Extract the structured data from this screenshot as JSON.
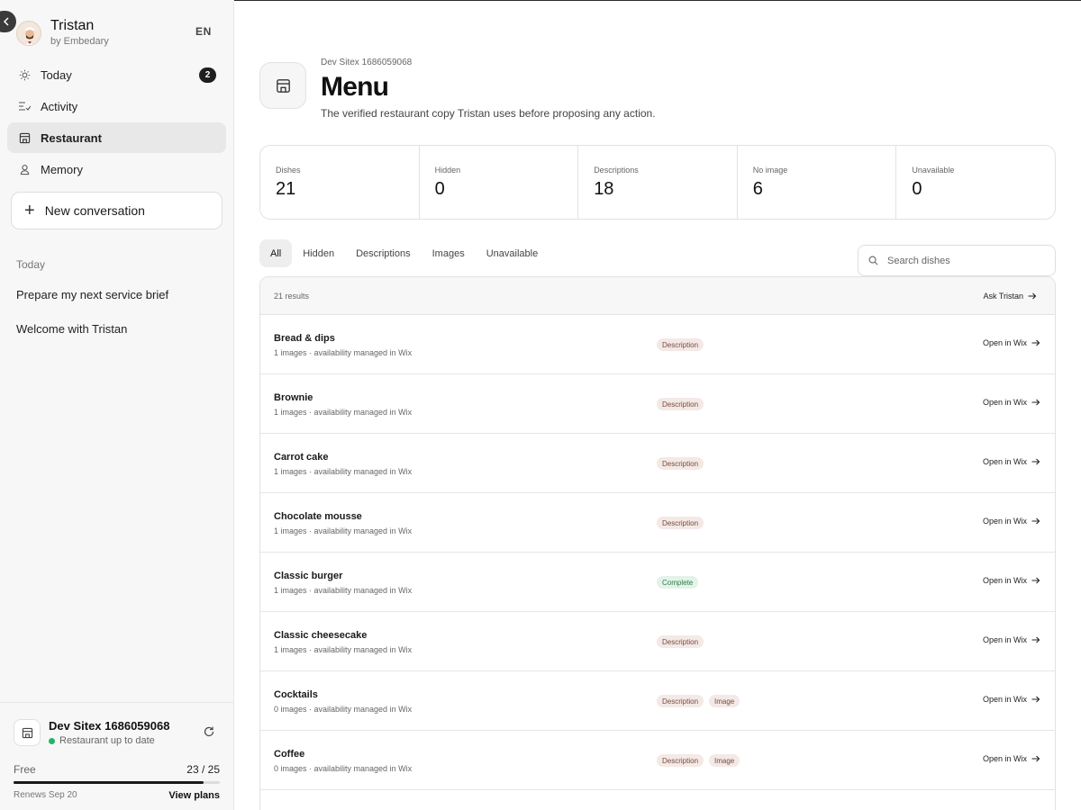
{
  "sidebar": {
    "profile": {
      "name": "Tristan",
      "subtitle": "by Embedary"
    },
    "language": "EN",
    "nav": [
      {
        "label": "Today",
        "icon": "sun-icon",
        "badge": "2"
      },
      {
        "label": "Activity",
        "icon": "activity-list-icon"
      },
      {
        "label": "Restaurant",
        "icon": "store-icon",
        "active": true
      },
      {
        "label": "Memory",
        "icon": "memory-icon"
      }
    ],
    "new_conversation_label": "New conversation",
    "history_section_label": "Today",
    "history": [
      "Prepare my next service brief",
      "Welcome with Tristan"
    ],
    "footer": {
      "site_name": "Dev Sitex 1686059068",
      "site_status": "Restaurant up to date",
      "status_color": "#26b36a",
      "plan_name": "Free",
      "plan_usage": "23 / 25",
      "plan_used": 23,
      "plan_limit": 25,
      "renews": "Renews Sep 20",
      "view_plans": "View plans"
    }
  },
  "main": {
    "eyebrow": "Dev Sitex 1686059068",
    "title": "Menu",
    "description": "The verified restaurant copy Tristan uses before proposing any action.",
    "stats": [
      {
        "label": "Dishes",
        "value": "21"
      },
      {
        "label": "Hidden",
        "value": "0"
      },
      {
        "label": "Descriptions",
        "value": "18"
      },
      {
        "label": "No image",
        "value": "6"
      },
      {
        "label": "Unavailable",
        "value": "0"
      }
    ],
    "tabs": [
      "All",
      "Hidden",
      "Descriptions",
      "Images",
      "Unavailable"
    ],
    "active_tab": "All",
    "search_placeholder": "Search dishes",
    "results_count": "21 results",
    "ask_label": "Ask Tristan",
    "open_label": "Open in Wix",
    "dishes": [
      {
        "name": "Bread & dips",
        "meta": "1 images · availability managed in Wix",
        "badges": [
          {
            "text": "Description",
            "kind": "warn"
          }
        ]
      },
      {
        "name": "Brownie",
        "meta": "1 images · availability managed in Wix",
        "badges": [
          {
            "text": "Description",
            "kind": "warn"
          }
        ]
      },
      {
        "name": "Carrot cake",
        "meta": "1 images · availability managed in Wix",
        "badges": [
          {
            "text": "Description",
            "kind": "warn"
          }
        ]
      },
      {
        "name": "Chocolate mousse",
        "meta": "1 images · availability managed in Wix",
        "badges": [
          {
            "text": "Description",
            "kind": "warn"
          }
        ]
      },
      {
        "name": "Classic burger",
        "meta": "1 images · availability managed in Wix",
        "badges": [
          {
            "text": "Complete",
            "kind": "ok"
          }
        ]
      },
      {
        "name": "Classic cheesecake",
        "meta": "1 images · availability managed in Wix",
        "badges": [
          {
            "text": "Description",
            "kind": "warn"
          }
        ]
      },
      {
        "name": "Cocktails",
        "meta": "0 images · availability managed in Wix",
        "badges": [
          {
            "text": "Description",
            "kind": "warn"
          },
          {
            "text": "Image",
            "kind": "warn"
          }
        ]
      },
      {
        "name": "Coffee",
        "meta": "0 images · availability managed in Wix",
        "badges": [
          {
            "text": "Description",
            "kind": "warn"
          },
          {
            "text": "Image",
            "kind": "warn"
          }
        ]
      },
      {
        "name": "",
        "meta": "",
        "badges": []
      }
    ]
  },
  "colors": {
    "badge_warn_bg": "#f3e9e6",
    "badge_warn_text": "#7a4a3e",
    "badge_ok_bg": "#e4f3e9",
    "badge_ok_text": "#2e7a4a",
    "active_nav_bg": "#e8e8e8"
  }
}
